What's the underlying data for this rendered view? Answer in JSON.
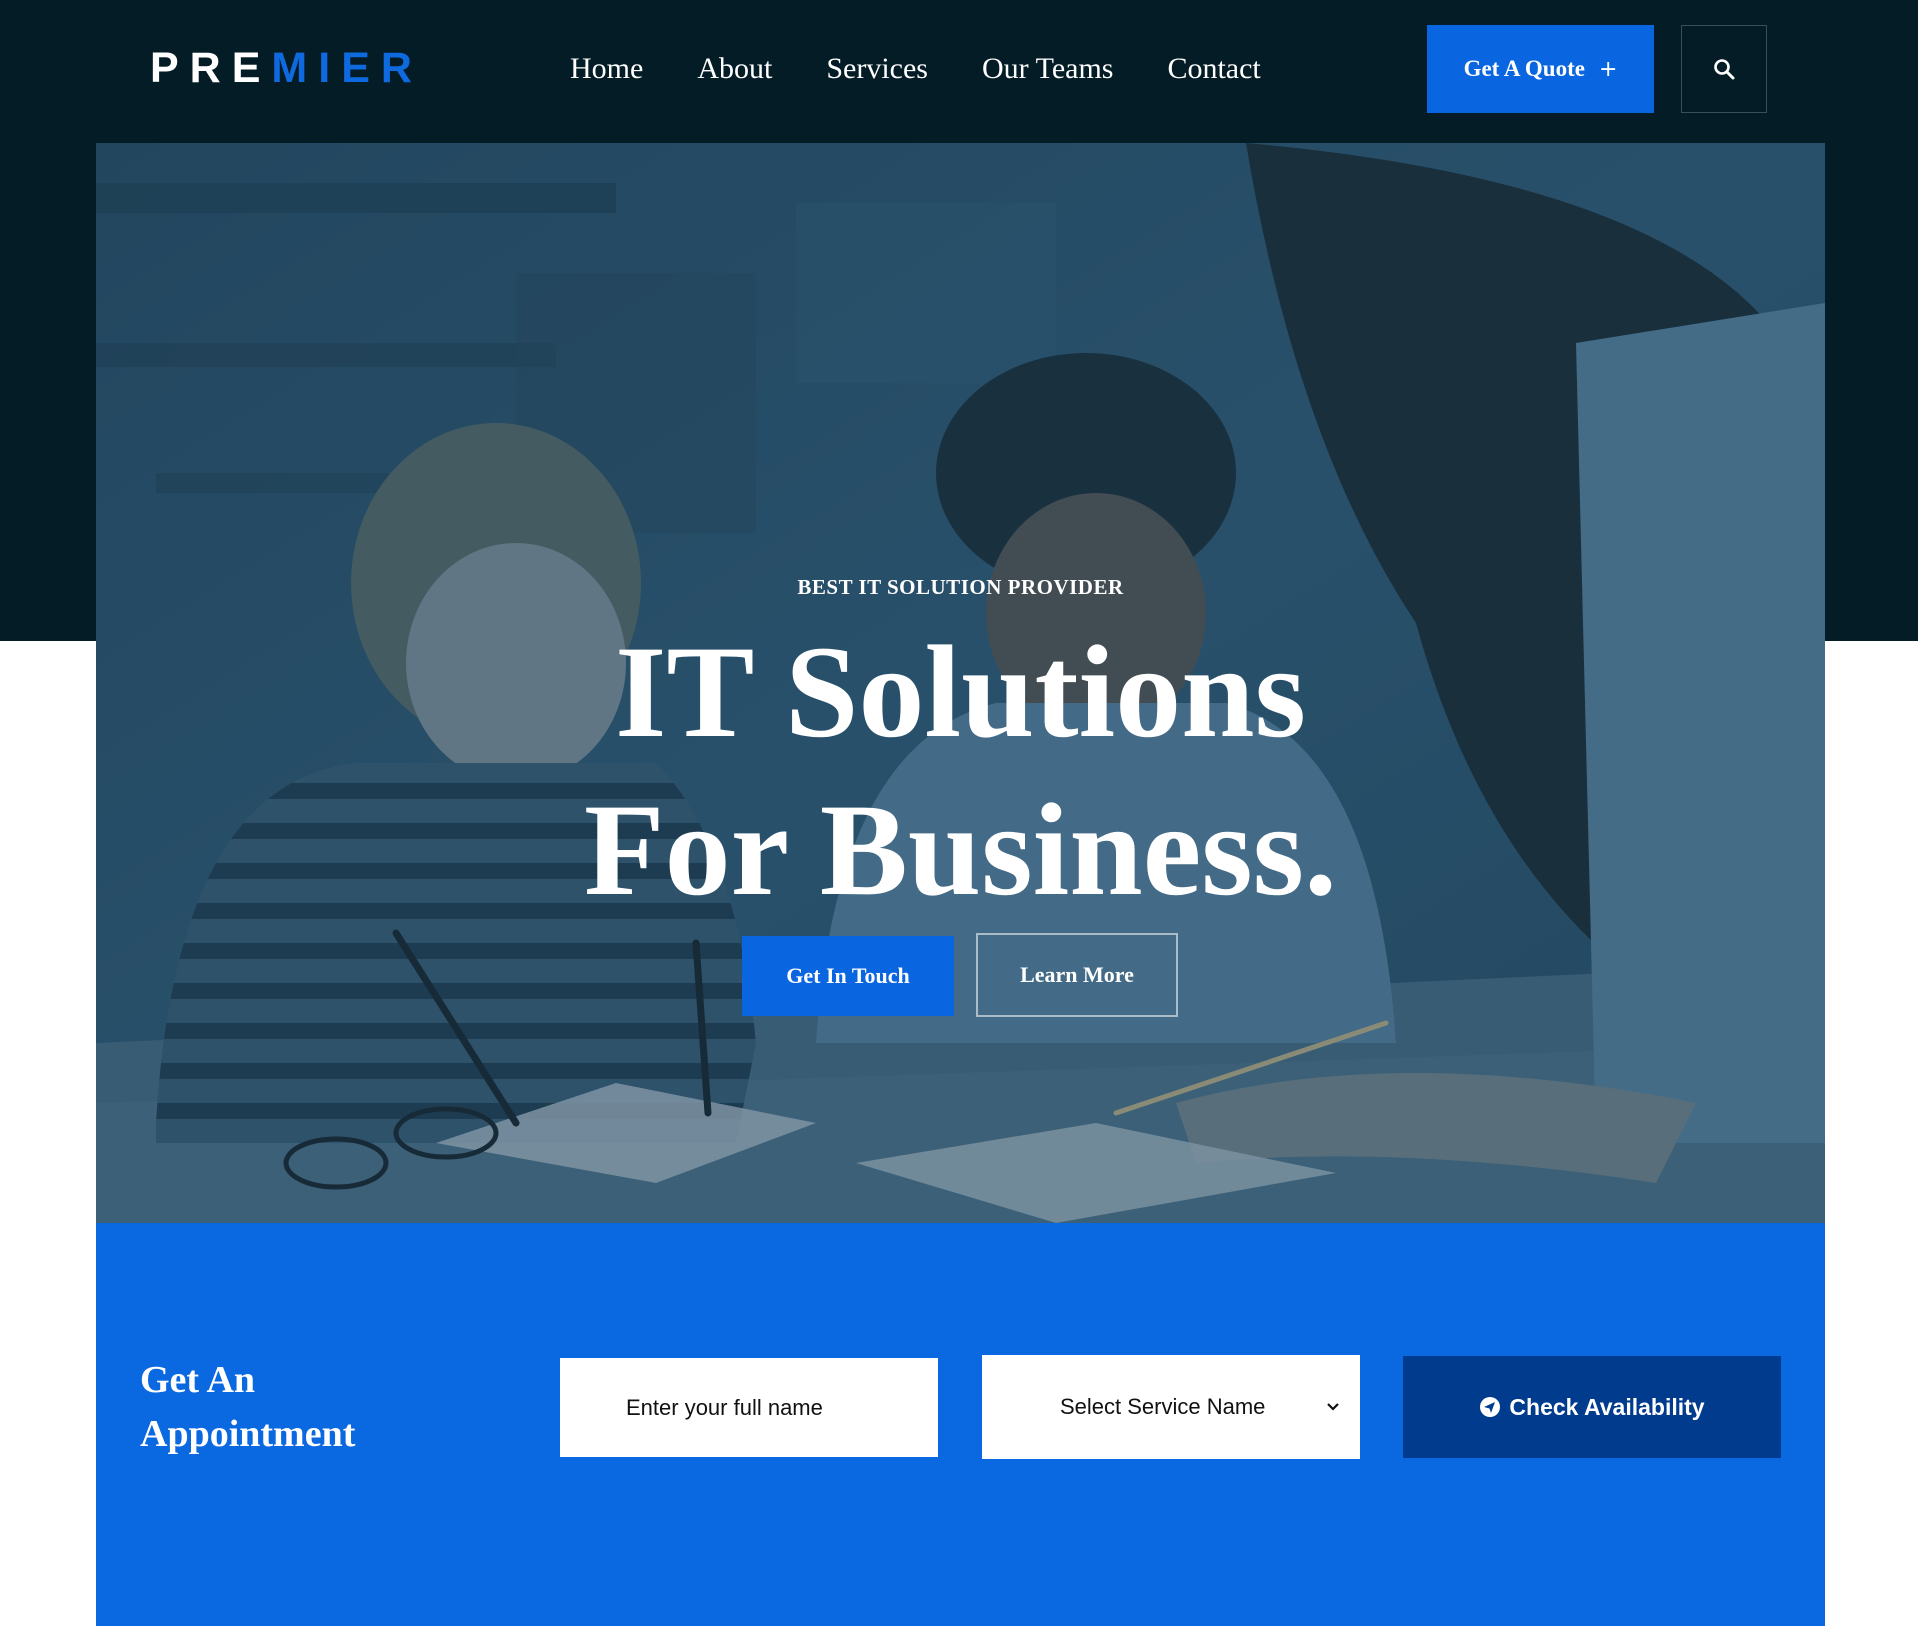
{
  "header": {
    "logo_part1": "PRE",
    "logo_part2": "MIER",
    "nav": [
      "Home",
      "About",
      "Services",
      "Our Teams",
      "Contact"
    ],
    "quote_label": "Get A Quote",
    "quote_symbol": "+"
  },
  "hero": {
    "eyebrow": "BEST IT SOLUTION PROVIDER",
    "headline_line1": "IT Solutions",
    "headline_line2": "For Business.",
    "primary_button": "Get In Touch",
    "secondary_button": "Learn More"
  },
  "appointment": {
    "title_line1": "Get An",
    "title_line2": "Appointment",
    "name_placeholder": "Enter your full name",
    "service_selected": "Select Service Name",
    "check_button": "Check Availability"
  },
  "colors": {
    "dark_navy": "#041c26",
    "brand_blue": "#0a66e0",
    "deep_blue": "#003b8e",
    "white": "#ffffff"
  },
  "icons": [
    "search-icon",
    "plus-icon",
    "chevron-down-icon",
    "send-icon"
  ]
}
